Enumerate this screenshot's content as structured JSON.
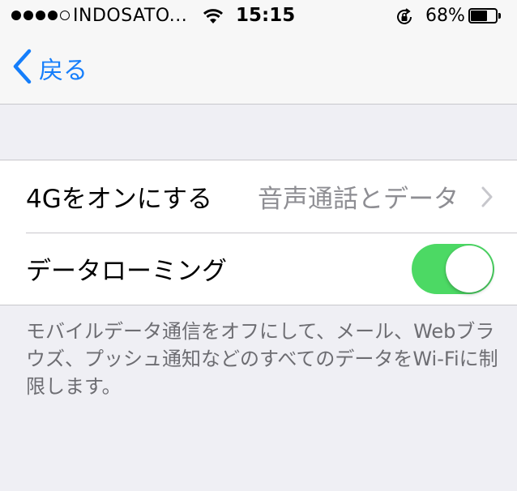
{
  "status_bar": {
    "signal_bars_filled": 4,
    "signal_bars_total": 5,
    "carrier": "INDOSATO...",
    "time": "15:15",
    "battery_percent": "68%",
    "battery_level": 0.68,
    "icons": [
      "wifi-icon",
      "rotation-lock-icon",
      "battery-icon"
    ]
  },
  "nav": {
    "back_label": "戻る",
    "accent_color": "#157efb"
  },
  "settings": {
    "rows": [
      {
        "label": "4Gをオンにする",
        "value": "音声通話とデータ",
        "accessory": "chevron-right-icon"
      },
      {
        "label": "データローミング",
        "toggle_on": true,
        "toggle_color": "#4cd964"
      }
    ],
    "footnote": "モバイルデータ通信をオフにして、メール、Webブラウズ、プッシュ通知などのすべてのデータをWi-Fiに制限します。"
  }
}
